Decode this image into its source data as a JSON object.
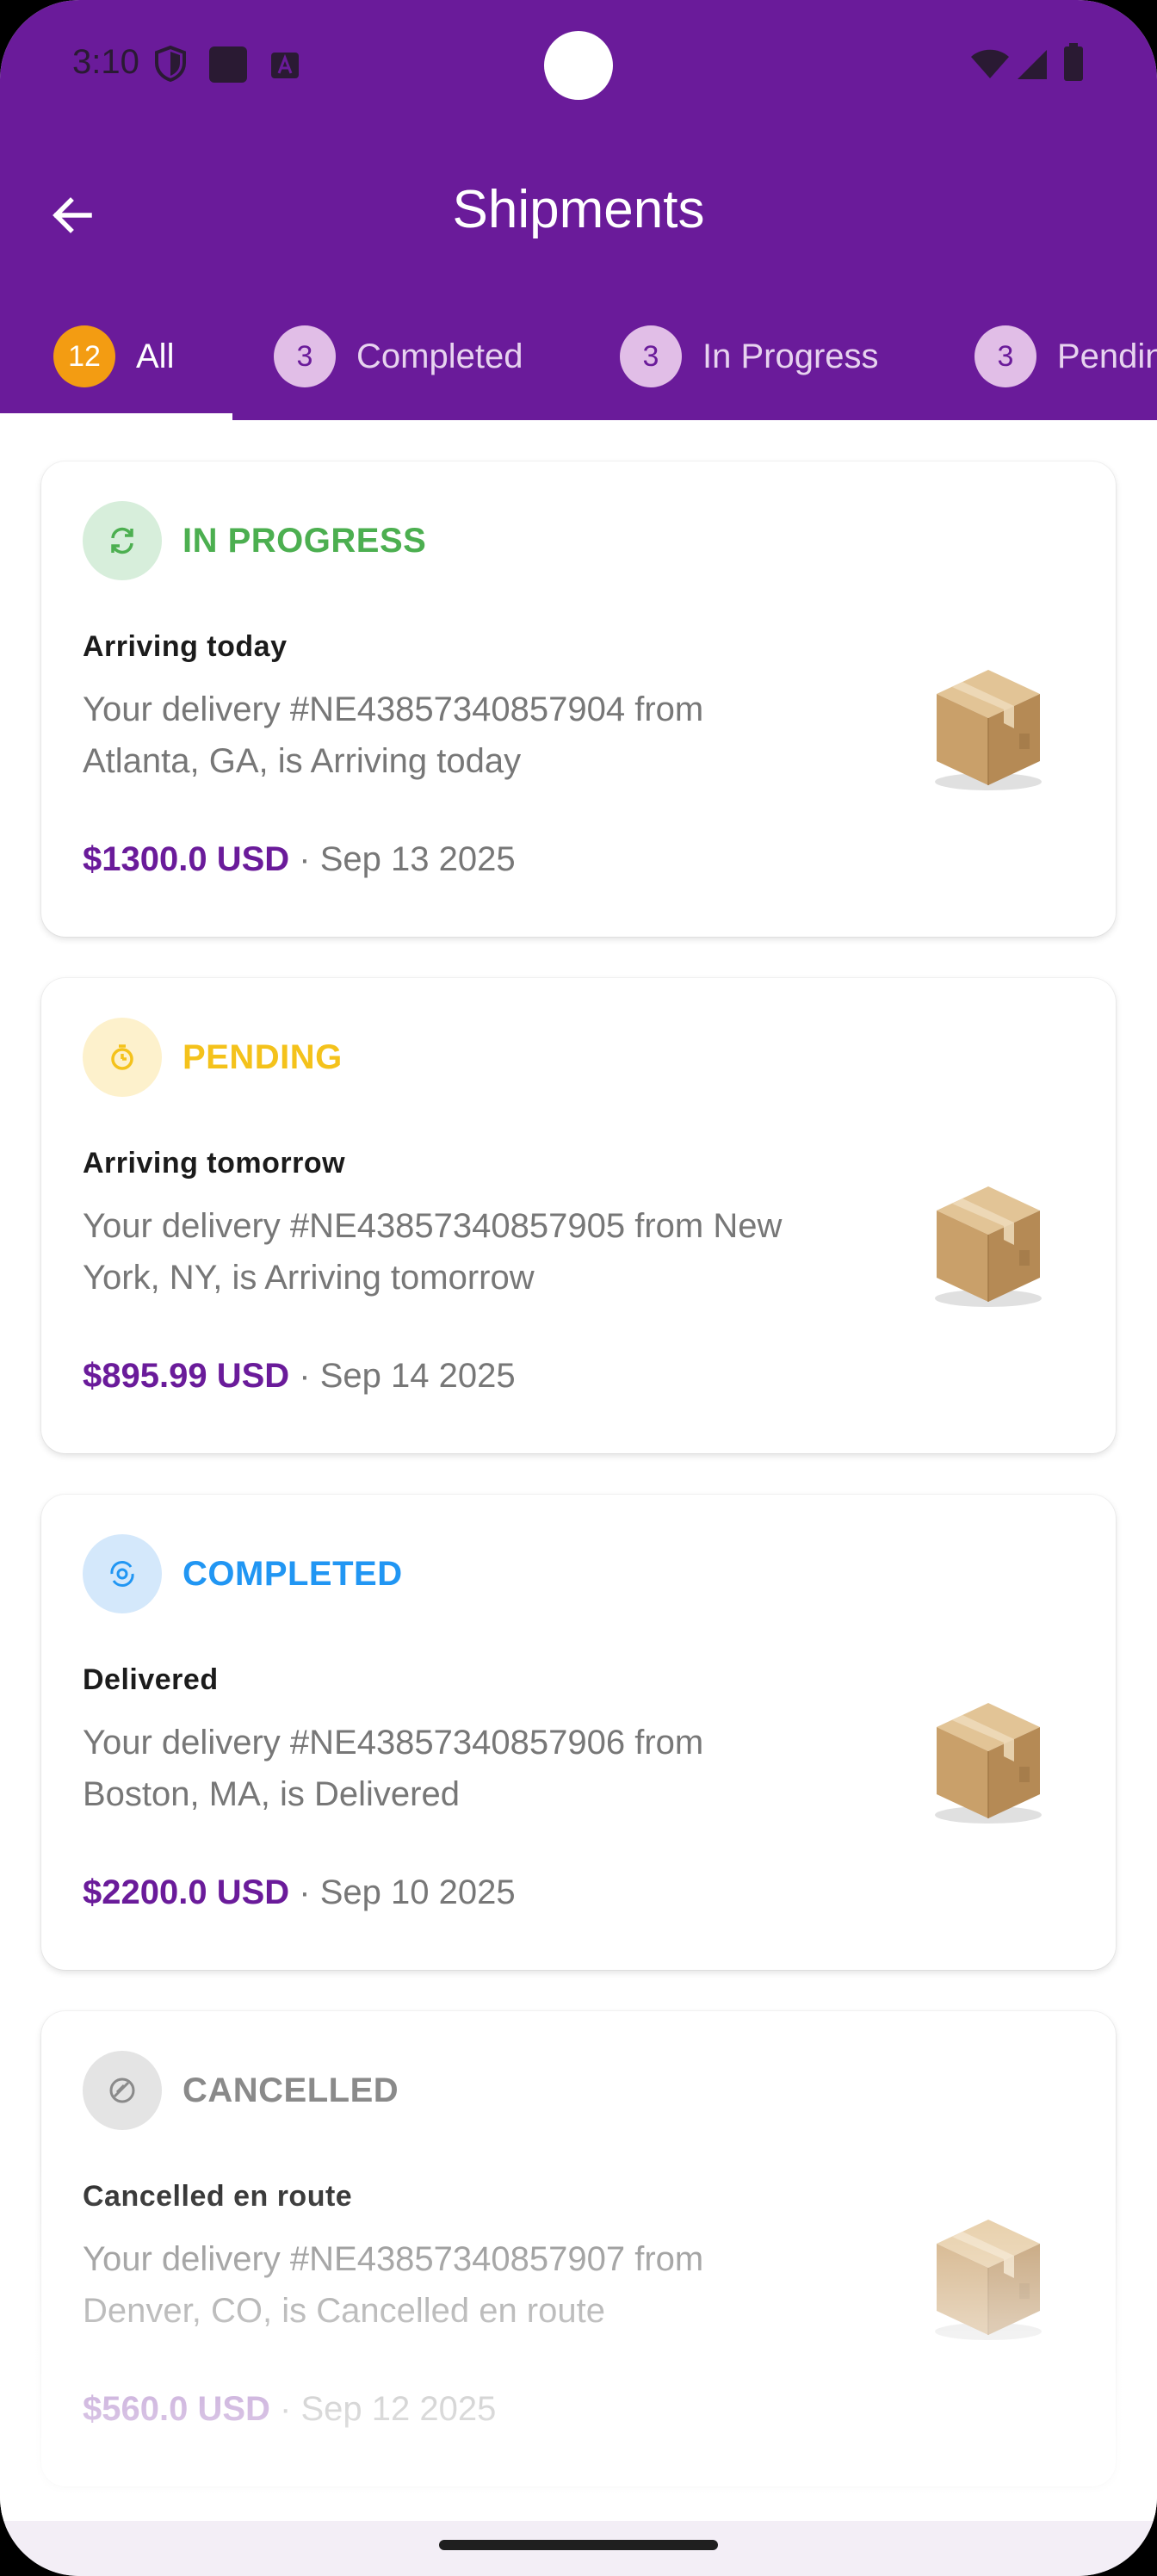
{
  "status_bar": {
    "time": "3:10",
    "icons": [
      "shield-icon",
      "app-square-icon",
      "a-badge-icon",
      "wifi-icon",
      "signal-icon",
      "battery-icon"
    ]
  },
  "header": {
    "title": "Shipments",
    "back_icon": "arrow-left-icon",
    "background_color": "#6a1b9a"
  },
  "tabs": [
    {
      "count": "12",
      "label": "All",
      "active": true
    },
    {
      "count": "3",
      "label": "Completed",
      "active": false
    },
    {
      "count": "3",
      "label": "In Progress",
      "active": false
    },
    {
      "count": "3",
      "label": "Pending",
      "active": false
    }
  ],
  "shipments": [
    {
      "status": "IN PROGRESS",
      "status_color": "#4caf50",
      "status_bg": "#d7eedb",
      "status_icon": "sync-icon",
      "heading": "Arriving today",
      "description": "Your delivery #NE43857340857904 from Atlanta, GA, is Arriving today",
      "price": "$1300.0 USD",
      "separator": " · ",
      "date": "Sep 13 2025"
    },
    {
      "status": "PENDING",
      "status_color": "#f4c21b",
      "status_bg": "#fdf1cc",
      "status_icon": "timer-icon",
      "heading": "Arriving tomorrow",
      "description": "Your delivery #NE43857340857905 from New York, NY, is Arriving tomorrow",
      "price": "$895.99 USD",
      "separator": " · ",
      "date": "Sep 14 2025"
    },
    {
      "status": "COMPLETED",
      "status_color": "#2196f3",
      "status_bg": "#d4e8fb",
      "status_icon": "check-cycle-icon",
      "heading": "Delivered",
      "description": "Your delivery #NE43857340857906 from Boston, MA, is Delivered",
      "price": "$2200.0 USD",
      "separator": " · ",
      "date": "Sep 10 2025"
    },
    {
      "status": "CANCELLED",
      "status_color": "#8a8a8a",
      "status_bg": "#e4e4e4",
      "status_icon": "cancel-icon",
      "heading": "Cancelled en route",
      "description": "Your delivery #NE43857340857907 from Denver, CO, is Cancelled en route",
      "price": "$560.0 USD",
      "separator": " · ",
      "date": "Sep 12 2025"
    }
  ],
  "package_icon": "cardboard-box-icon"
}
